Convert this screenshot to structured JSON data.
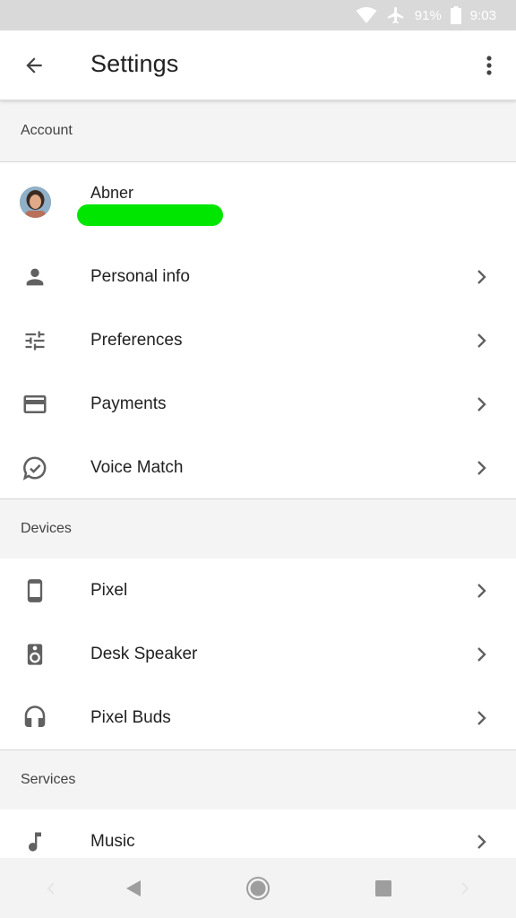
{
  "status_bar": {
    "battery": "91%",
    "time": "9:03"
  },
  "app_bar": {
    "title": "Settings"
  },
  "sections": {
    "account": "Account",
    "devices": "Devices",
    "services": "Services"
  },
  "profile": {
    "name": "Abner"
  },
  "account_items": [
    {
      "label": "Personal info",
      "icon": "person-icon"
    },
    {
      "label": "Preferences",
      "icon": "tune-icon"
    },
    {
      "label": "Payments",
      "icon": "credit-card-icon"
    },
    {
      "label": "Voice Match",
      "icon": "voice-match-icon"
    }
  ],
  "device_items": [
    {
      "label": "Pixel",
      "icon": "phone-icon"
    },
    {
      "label": "Desk Speaker",
      "icon": "speaker-icon"
    },
    {
      "label": "Pixel Buds",
      "icon": "headphones-icon"
    }
  ],
  "service_items": [
    {
      "label": "Music",
      "icon": "music-note-icon"
    }
  ],
  "colors": {
    "icon": "#616161",
    "section_bg": "#f4f4f4",
    "redaction": "#00e600"
  }
}
